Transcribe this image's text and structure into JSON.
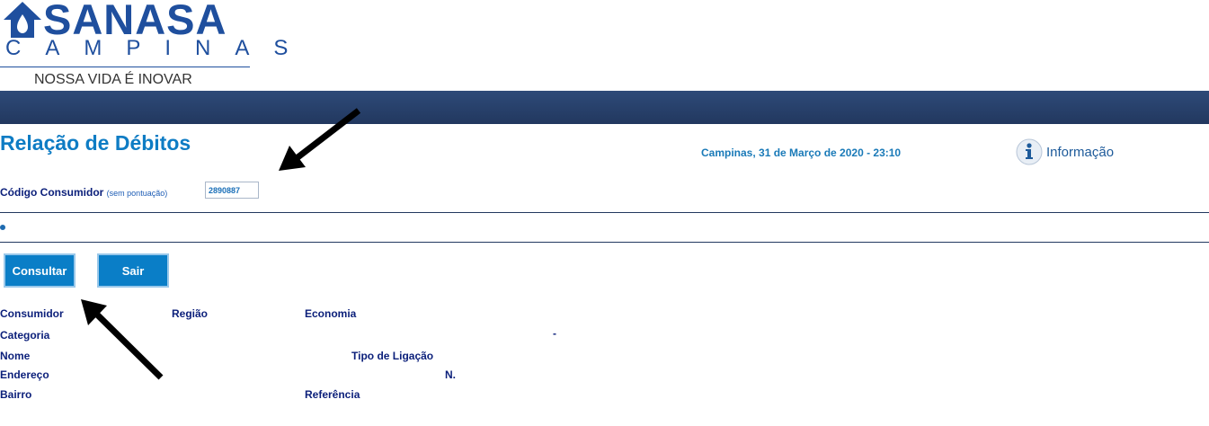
{
  "logo": {
    "brand": "SANASA",
    "city": "CAMPINAS",
    "tagline": "NOSSA VIDA É INOVAR"
  },
  "page": {
    "title": "Relação de Débitos",
    "date": "Campinas, 31 de Março de 2020 - 23:10",
    "info_label": "Informação"
  },
  "form": {
    "code_label": "Código Consumidor",
    "code_hint": "(sem pontuação)",
    "code_value": "2890887"
  },
  "buttons": {
    "consult": "Consultar",
    "exit": "Sair"
  },
  "details": {
    "consumer": "Consumidor",
    "region": "Região",
    "economy": "Economia",
    "category": "Categoria",
    "dash": "-",
    "name": "Nome",
    "connection_type": "Tipo de Ligação",
    "address": "Endereço",
    "number": "N.",
    "neighborhood": "Bairro",
    "reference": "Referência"
  },
  "colors": {
    "banner": "#2e4a78",
    "title": "#0e7cc4",
    "button": "#0a7ec7",
    "label": "#0b1f7a"
  }
}
